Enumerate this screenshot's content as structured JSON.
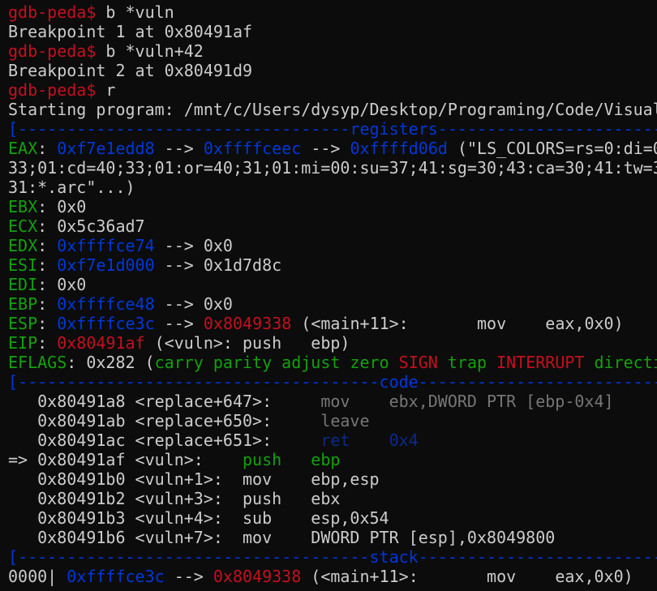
{
  "terminal": {
    "colors": {
      "background": "#0c0c0c",
      "foreground": "#cccccc",
      "red": "#c50f1f",
      "green": "#13a10e",
      "blue": "#0037da",
      "gray": "#767676",
      "dim_blue": "#0a2a8a"
    },
    "prompt": "gdb-peda$",
    "lines": [
      {
        "kind": "command",
        "name": "cmd-break-vuln",
        "interactable": true,
        "segments": [
          {
            "t": "gdb-peda$",
            "c": "red"
          },
          {
            "t": " b *vuln",
            "c": "plain"
          }
        ]
      },
      {
        "kind": "output",
        "name": "breakpoint-1-output",
        "segments": [
          {
            "t": "Breakpoint 1 at 0x80491af",
            "c": "plain"
          }
        ]
      },
      {
        "kind": "command",
        "name": "cmd-break-vuln-42",
        "interactable": true,
        "segments": [
          {
            "t": "gdb-peda$",
            "c": "red"
          },
          {
            "t": " b *vuln+42",
            "c": "plain"
          }
        ]
      },
      {
        "kind": "output",
        "name": "breakpoint-2-output",
        "segments": [
          {
            "t": "Breakpoint 2 at 0x80491d9",
            "c": "plain"
          }
        ]
      },
      {
        "kind": "command",
        "name": "cmd-run",
        "interactable": true,
        "segments": [
          {
            "t": "gdb-peda$",
            "c": "red"
          },
          {
            "t": " r",
            "c": "plain"
          }
        ]
      },
      {
        "kind": "output",
        "name": "starting-program-output",
        "segments": [
          {
            "t": "Starting program: /mnt/c/Users/dysyp/Desktop/Programing/Code/Visual",
            "c": "plain"
          }
        ]
      },
      {
        "kind": "separator",
        "name": "registers-separator",
        "segments": [
          {
            "t": "[----------------------------------registers-----------------------------------]",
            "c": "blue"
          }
        ]
      },
      {
        "kind": "register",
        "name": "register-eax",
        "segments": [
          {
            "t": "EAX",
            "c": "green"
          },
          {
            "t": ": ",
            "c": "plain"
          },
          {
            "t": "0xf7e1edd8",
            "c": "blue"
          },
          {
            "t": " --> ",
            "c": "plain"
          },
          {
            "t": "0xffffceec",
            "c": "blue"
          },
          {
            "t": " --> ",
            "c": "plain"
          },
          {
            "t": "0xffffd06d",
            "c": "blue"
          },
          {
            "t": " (\"LS_COLORS=rs=0:di=0",
            "c": "plain"
          }
        ]
      },
      {
        "kind": "output",
        "name": "register-eax-cont-1",
        "segments": [
          {
            "t": "33;01:cd=40;33;01:or=40;31;01:mi=00:su=37;41:sg=30;43:ca=30;41:tw=3",
            "c": "plain"
          }
        ]
      },
      {
        "kind": "output",
        "name": "register-eax-cont-2",
        "segments": [
          {
            "t": "31:*.arc\"...)",
            "c": "plain"
          }
        ]
      },
      {
        "kind": "register",
        "name": "register-ebx",
        "segments": [
          {
            "t": "EBX",
            "c": "green"
          },
          {
            "t": ": 0x0",
            "c": "plain"
          }
        ]
      },
      {
        "kind": "register",
        "name": "register-ecx",
        "segments": [
          {
            "t": "ECX",
            "c": "green"
          },
          {
            "t": ": 0x5c36ad7",
            "c": "plain"
          }
        ]
      },
      {
        "kind": "register",
        "name": "register-edx",
        "segments": [
          {
            "t": "EDX",
            "c": "green"
          },
          {
            "t": ": ",
            "c": "plain"
          },
          {
            "t": "0xffffce74",
            "c": "blue"
          },
          {
            "t": " --> 0x0",
            "c": "plain"
          }
        ]
      },
      {
        "kind": "register",
        "name": "register-esi",
        "segments": [
          {
            "t": "ESI",
            "c": "green"
          },
          {
            "t": ": ",
            "c": "plain"
          },
          {
            "t": "0xf7e1d000",
            "c": "blue"
          },
          {
            "t": " --> 0x1d7d8c",
            "c": "plain"
          }
        ]
      },
      {
        "kind": "register",
        "name": "register-edi",
        "segments": [
          {
            "t": "EDI",
            "c": "green"
          },
          {
            "t": ": 0x0",
            "c": "plain"
          }
        ]
      },
      {
        "kind": "register",
        "name": "register-ebp",
        "segments": [
          {
            "t": "EBP",
            "c": "green"
          },
          {
            "t": ": ",
            "c": "plain"
          },
          {
            "t": "0xffffce48",
            "c": "blue"
          },
          {
            "t": " --> 0x0",
            "c": "plain"
          }
        ]
      },
      {
        "kind": "register",
        "name": "register-esp",
        "segments": [
          {
            "t": "ESP",
            "c": "green"
          },
          {
            "t": ": ",
            "c": "plain"
          },
          {
            "t": "0xffffce3c",
            "c": "blue"
          },
          {
            "t": " --> ",
            "c": "plain"
          },
          {
            "t": "0x8049338",
            "c": "red"
          },
          {
            "t": " (<main+11>:       mov    eax,0x0)",
            "c": "plain"
          }
        ]
      },
      {
        "kind": "register",
        "name": "register-eip",
        "segments": [
          {
            "t": "EIP",
            "c": "green"
          },
          {
            "t": ": ",
            "c": "plain"
          },
          {
            "t": "0x80491af",
            "c": "red"
          },
          {
            "t": " (<vuln>: push   ebp)",
            "c": "plain"
          }
        ]
      },
      {
        "kind": "register",
        "name": "register-eflags",
        "segments": [
          {
            "t": "EFLAGS",
            "c": "green"
          },
          {
            "t": ": 0x282 (",
            "c": "plain"
          },
          {
            "t": "carry parity adjust zero ",
            "c": "green"
          },
          {
            "t": "SIGN",
            "c": "red"
          },
          {
            "t": " ",
            "c": "plain"
          },
          {
            "t": "trap",
            "c": "green"
          },
          {
            "t": " ",
            "c": "plain"
          },
          {
            "t": "INTERRUPT",
            "c": "red"
          },
          {
            "t": " ",
            "c": "plain"
          },
          {
            "t": "directi",
            "c": "green"
          }
        ]
      },
      {
        "kind": "separator",
        "name": "code-separator",
        "segments": [
          {
            "t": "[-------------------------------------code-------------------------------------]",
            "c": "blue"
          }
        ]
      },
      {
        "kind": "code",
        "name": "code-line",
        "segments": [
          {
            "t": "   0x80491a8 <replace+647>:     ",
            "c": "plain"
          },
          {
            "t": "mov    ebx,DWORD PTR [ebp-0x4]",
            "c": "gray"
          }
        ]
      },
      {
        "kind": "code",
        "name": "code-line",
        "segments": [
          {
            "t": "   0x80491ab <replace+650>:     ",
            "c": "plain"
          },
          {
            "t": "leave",
            "c": "gray"
          }
        ]
      },
      {
        "kind": "code",
        "name": "code-line",
        "segments": [
          {
            "t": "   0x80491ac <replace+651>:     ",
            "c": "plain"
          },
          {
            "t": "ret    0x4",
            "c": "dblue"
          }
        ]
      },
      {
        "kind": "code",
        "name": "code-line-current",
        "segments": [
          {
            "t": "=> 0x80491af <vuln>:    ",
            "c": "plain"
          },
          {
            "t": "push   ebp",
            "c": "green"
          }
        ]
      },
      {
        "kind": "code",
        "name": "code-line",
        "segments": [
          {
            "t": "   0x80491b0 <vuln+1>:  mov    ebp,esp",
            "c": "plain"
          }
        ]
      },
      {
        "kind": "code",
        "name": "code-line",
        "segments": [
          {
            "t": "   0x80491b2 <vuln+3>:  push   ebx",
            "c": "plain"
          }
        ]
      },
      {
        "kind": "code",
        "name": "code-line",
        "segments": [
          {
            "t": "   0x80491b3 <vuln+4>:  sub    esp,0x54",
            "c": "plain"
          }
        ]
      },
      {
        "kind": "code",
        "name": "code-line",
        "segments": [
          {
            "t": "   0x80491b6 <vuln+7>:  mov    DWORD PTR [esp],0x8049800",
            "c": "plain"
          }
        ]
      },
      {
        "kind": "separator",
        "name": "stack-separator",
        "segments": [
          {
            "t": "[------------------------------------stack-------------------------------------]",
            "c": "blue"
          }
        ]
      },
      {
        "kind": "stack",
        "name": "stack-entry",
        "segments": [
          {
            "t": "0000| ",
            "c": "plain"
          },
          {
            "t": "0xffffce3c",
            "c": "blue"
          },
          {
            "t": " --> ",
            "c": "plain"
          },
          {
            "t": "0x8049338",
            "c": "red"
          },
          {
            "t": " (<main+11>:       mov    eax,0x0)",
            "c": "plain"
          }
        ]
      }
    ]
  }
}
